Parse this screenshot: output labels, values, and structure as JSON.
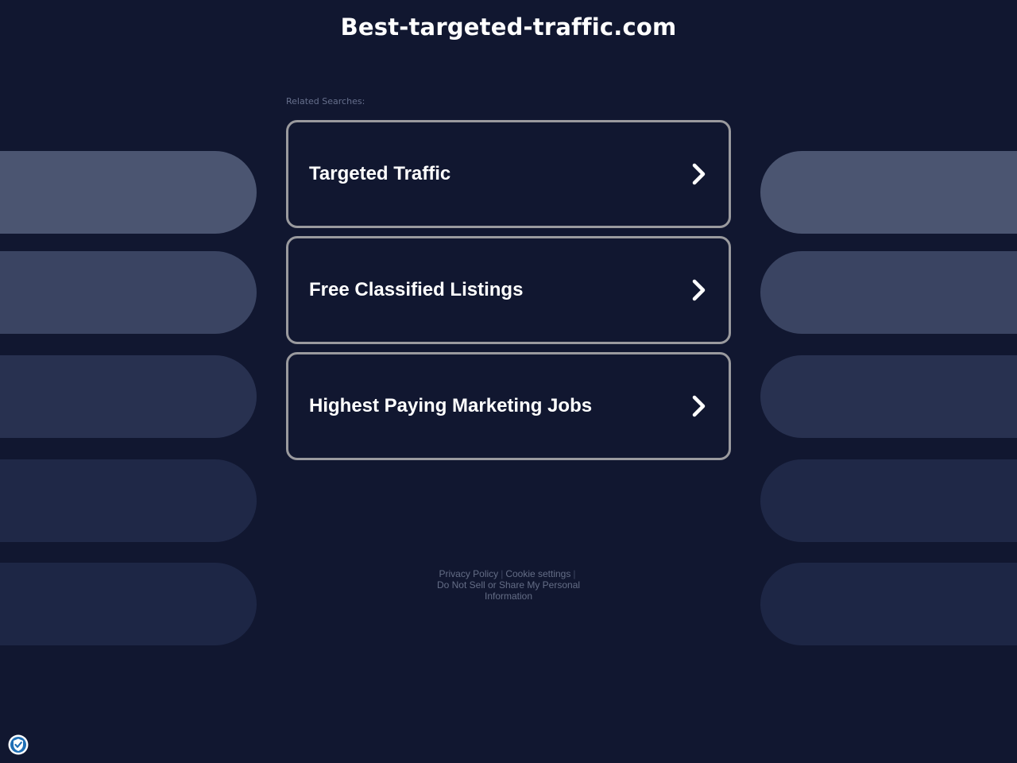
{
  "header": {
    "site_title": "Best-targeted-traffic.com"
  },
  "related": {
    "label": "Related Searches:",
    "items": [
      {
        "label": "Targeted Traffic",
        "icon": "chevron-right-icon"
      },
      {
        "label": "Free Classified Listings",
        "icon": "chevron-right-icon"
      },
      {
        "label": "Highest Paying Marketing Jobs",
        "icon": "chevron-right-icon"
      }
    ]
  },
  "footer": {
    "privacy_policy": "Privacy Policy",
    "separator": "|",
    "cookie_settings": "Cookie settings",
    "do_not_sell": "Do Not Sell or Share My Personal Information"
  },
  "badge": {
    "icon": "privacy-shield-check-icon"
  },
  "colors": {
    "background": "#111730",
    "card_border": "#9a9a9e",
    "text_primary": "#ffffff",
    "text_muted": "#666f8c",
    "pill_row_1": "#4b5571",
    "pill_row_2": "#3a4462",
    "pill_row_3": "#283150",
    "pill_row_4": "#1f2847",
    "pill_row_5": "#1d2645"
  }
}
